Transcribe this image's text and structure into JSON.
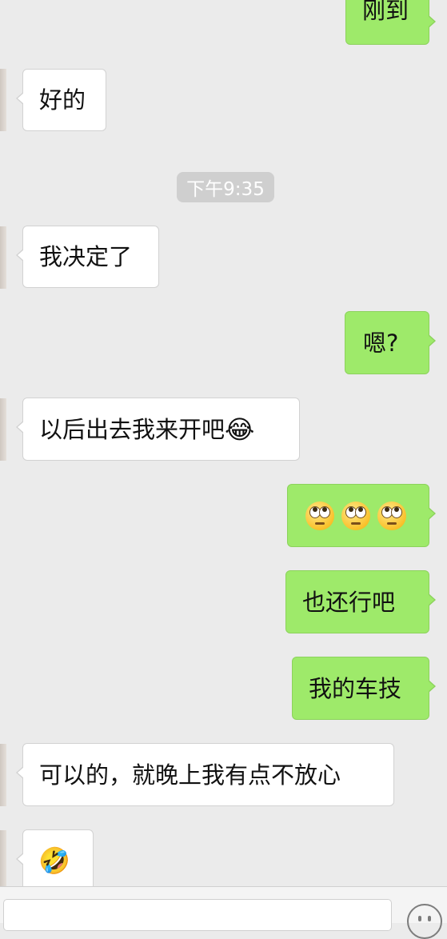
{
  "timestamp": "下午9:35",
  "messages": [
    {
      "side": "out",
      "text": "刚到"
    },
    {
      "side": "in",
      "text": "好的"
    },
    {
      "side": "in",
      "text": "我决定了"
    },
    {
      "side": "out",
      "text": "嗯?"
    },
    {
      "side": "in",
      "text": "以后出去我来开吧",
      "emoji": "tears-of-joy-emoji"
    },
    {
      "side": "out",
      "emoji": "eye-roll-emoji",
      "emoji_count": 3
    },
    {
      "side": "out",
      "text": "也还行吧"
    },
    {
      "side": "out",
      "text": "我的车技"
    },
    {
      "side": "in",
      "text": "可以的，就晚上我有点不放心"
    },
    {
      "side": "in",
      "emoji": "rolling-on-floor-laughing-emoji"
    }
  ],
  "emoji_glyphs": {
    "tears_of_joy": "😂",
    "rolling_laughing": "🤣"
  },
  "input": {
    "placeholder": "",
    "emoji_button_icon": "smiley-icon"
  },
  "colors": {
    "background": "#ebebeb",
    "incoming_bubble": "#ffffff",
    "outgoing_bubble": "#9eea6a"
  }
}
